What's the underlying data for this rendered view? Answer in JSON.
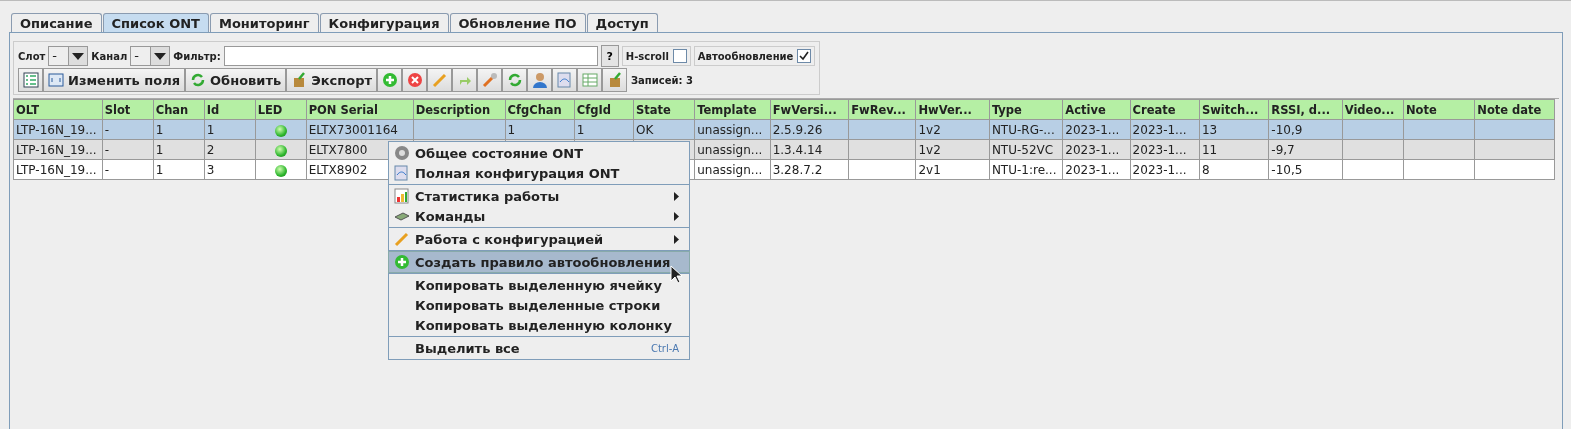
{
  "tabs": [
    {
      "label": "Описание",
      "selected": false
    },
    {
      "label": "Список ONT",
      "selected": true
    },
    {
      "label": "Мониторинг",
      "selected": false
    },
    {
      "label": "Конфигурация",
      "selected": false
    },
    {
      "label": "Обновление ПО",
      "selected": false
    },
    {
      "label": "Доступ",
      "selected": false
    }
  ],
  "filters": {
    "slot_label": "Слот",
    "slot_value": "-",
    "channel_label": "Канал",
    "channel_value": "-",
    "filter_label": "Фильтр:",
    "help_button": "?",
    "hscroll": {
      "label": "H-scroll",
      "checked": false
    },
    "autoupdate": {
      "label": "Автообновление",
      "checked": true
    }
  },
  "toolbar": {
    "buttons": [
      "Изменить поля",
      "Обновить",
      "Экспорт"
    ],
    "records": "Записей: 3"
  },
  "table": {
    "columns": [
      "OLT",
      "Slot",
      "Chan",
      "Id",
      "LED",
      "PON Serial",
      "Description",
      "CfgChan",
      "CfgId",
      "State",
      "Template",
      "FwVersi...",
      "FwRev...",
      "HwVer...",
      "Type",
      "Active",
      "Create",
      "Switch...",
      "RSSI, d...",
      "Video...",
      "Note",
      "Note date"
    ],
    "rows": [
      {
        "selected": true,
        "led_on": true,
        "cells": [
          "LTP-16N_19...",
          "-",
          "1",
          "1",
          null,
          "ELTX73001164",
          null,
          "1",
          "1",
          "OK",
          "unassign...",
          "2.5.9.26",
          null,
          "1v2",
          "NTU-RG-...",
          "2023-1...",
          "2023-1...",
          "13",
          "-10,9",
          null,
          null,
          null
        ]
      },
      {
        "selected": false,
        "led_on": true,
        "cells": [
          "LTP-16N_19...",
          "-",
          "1",
          "2",
          null,
          "ELTX7800",
          null,
          null,
          null,
          null,
          "unassign...",
          "1.3.4.14",
          null,
          "1v2",
          "NTU-52VC",
          "2023-1...",
          "2023-1...",
          "11",
          " -9,7",
          null,
          null,
          null
        ]
      },
      {
        "selected": false,
        "led_on": true,
        "cells": [
          "LTP-16N_19...",
          "-",
          "1",
          "3",
          null,
          "ELTX8902",
          null,
          null,
          null,
          null,
          "unassign...",
          "3.28.7.2",
          null,
          "2v1",
          "NTU-1:re...",
          "2023-1...",
          "2023-1...",
          "8",
          "-10,5",
          null,
          null,
          null
        ]
      }
    ]
  },
  "context_menu": {
    "groups": [
      [
        {
          "label": "Общее состояние ONT",
          "submenu": false,
          "selected": false
        },
        {
          "label": "Полная конфигурация ONT",
          "submenu": false,
          "selected": false
        }
      ],
      [
        {
          "label": "Статистика работы",
          "submenu": true,
          "selected": false
        },
        {
          "label": "Команды",
          "submenu": true,
          "selected": false
        }
      ],
      [
        {
          "label": "Работа с конфигурацией",
          "submenu": true,
          "selected": false
        }
      ],
      [
        {
          "label": "Создать правило автообновления",
          "submenu": false,
          "selected": true
        }
      ],
      [
        {
          "label": "Копировать выделенную ячейку",
          "submenu": false,
          "selected": false
        },
        {
          "label": "Копировать выделенные строки",
          "submenu": false,
          "selected": false
        },
        {
          "label": "Копировать выделенную колонку",
          "submenu": false,
          "selected": false
        }
      ],
      [
        {
          "label": "Выделить все",
          "submenu": false,
          "selected": false,
          "shortcut": "Ctrl-A"
        }
      ]
    ]
  }
}
